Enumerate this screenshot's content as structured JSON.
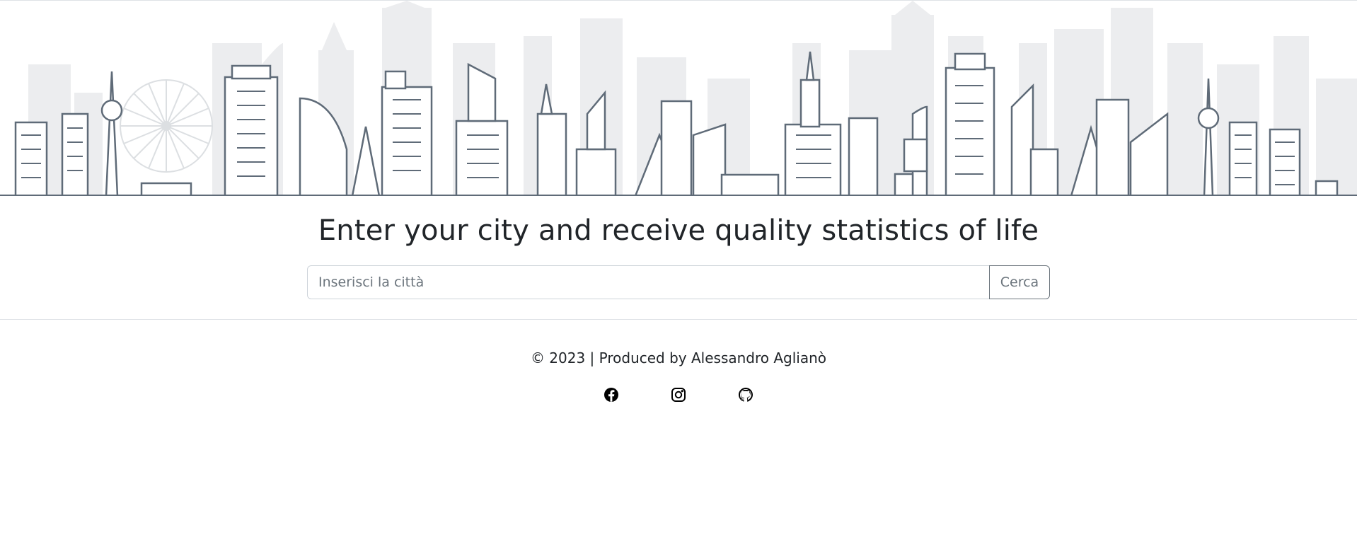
{
  "main": {
    "headline": "Enter your city and receive quality statistics of life"
  },
  "search": {
    "placeholder": "Inserisci la città",
    "value": "",
    "button_label": "Cerca"
  },
  "footer": {
    "copyright": "© 2023 | Produced by Alessandro Aglianò",
    "social_links": [
      {
        "icon": "facebook-icon"
      },
      {
        "icon": "instagram-icon"
      },
      {
        "icon": "github-icon"
      }
    ]
  },
  "colors": {
    "text": "#212529",
    "muted": "#6c757d",
    "border": "#ced4da",
    "skyline_line": "#5f6b78",
    "skyline_bg": "#e9ebed"
  }
}
